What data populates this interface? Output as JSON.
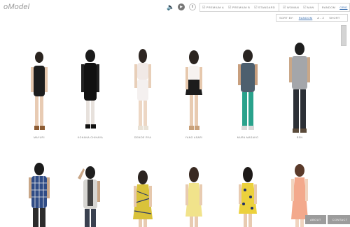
{
  "brand": {
    "logo_text": "oModel"
  },
  "controls": {
    "play_glyph": "▶",
    "pause_glyph": "II",
    "speaker_glyph": "🔈"
  },
  "filters": [
    {
      "label": "PREMIUM A",
      "icon": "check-icon"
    },
    {
      "label": "PREMIUM B",
      "icon": "check-icon"
    },
    {
      "label": "STANDARD",
      "icon": "check-icon"
    },
    {
      "label": "WOMAN",
      "icon": "check-icon"
    },
    {
      "label": "MAN",
      "icon": "check-icon"
    },
    {
      "label": "RANDOM",
      "icon": ""
    },
    {
      "label": "GRID",
      "icon": "",
      "active": true
    }
  ],
  "sort": {
    "label": "SORT BY:",
    "options": [
      "RANDOM",
      "A - Z",
      "SHORT"
    ],
    "active": "RANDOM"
  },
  "models_row1": [
    {
      "name": "MAYURI",
      "gender": "f"
    },
    {
      "name": "KOHANA CHIHAYA",
      "gender": "f"
    },
    {
      "name": "DEMOE RYA",
      "gender": "f"
    },
    {
      "name": "YANO ASARI",
      "gender": "f"
    },
    {
      "name": "MURA MASAKO",
      "gender": "m"
    },
    {
      "name": "REN",
      "gender": "m"
    }
  ],
  "footer": {
    "about": "ABOUT",
    "contact": "CONTACT"
  },
  "colors": {
    "accent": "#3a6fb0"
  }
}
